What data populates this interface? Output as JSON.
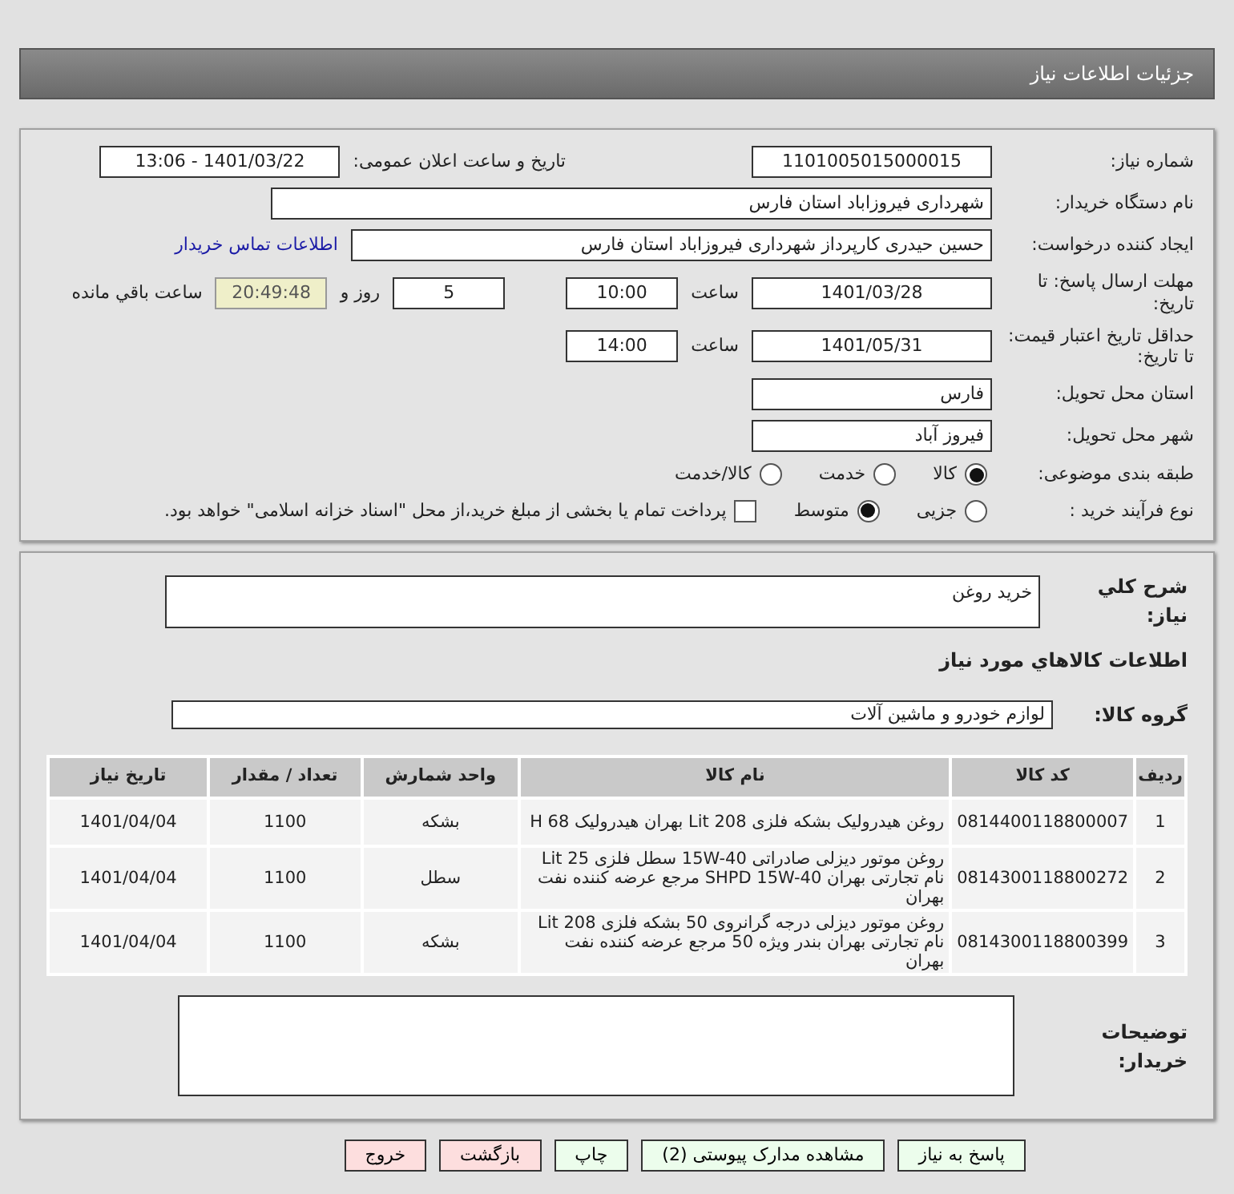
{
  "header": {
    "title": "جزئیات اطلاعات نیاز"
  },
  "need_number": {
    "label": "شماره نیاز:",
    "value": "1101005015000015"
  },
  "announce": {
    "label": "تاریخ و ساعت اعلان عمومی:",
    "value": "1401/03/22 - 13:06"
  },
  "buyer_org": {
    "label": "نام دستگاه خریدار:",
    "value": "شهرداری فیروزاباد استان فارس"
  },
  "requester": {
    "label": "ایجاد کننده درخواست:",
    "value": "حسین حیدری کارپرداز شهرداری فیروزاباد استان فارس",
    "link": "اطلاعات تماس خریدار"
  },
  "reply_deadline": {
    "label": "مهلت ارسال پاسخ: تا تاریخ:",
    "date": "1401/03/28",
    "time_label": "ساعت",
    "time": "10:00",
    "days": "5",
    "days_label": "روز و",
    "remaining": "20:49:48",
    "remaining_label": "ساعت باقي مانده"
  },
  "price_validity": {
    "label": "حداقل تاریخ اعتبار قیمت: تا تاریخ:",
    "date": "1401/05/31",
    "time_label": "ساعت",
    "time": "14:00"
  },
  "province": {
    "label": "استان محل تحویل:",
    "value": "فارس"
  },
  "city": {
    "label": "شهر محل تحویل:",
    "value": "فیروز آباد"
  },
  "category": {
    "label": "طبقه بندی موضوعی:",
    "options": [
      {
        "label": "کالا",
        "selected": true
      },
      {
        "label": "خدمت",
        "selected": false
      },
      {
        "label": "کالا/خدمت",
        "selected": false
      }
    ]
  },
  "process": {
    "label": "نوع فرآیند خرید :",
    "options": [
      {
        "label": "جزیی",
        "selected": false
      },
      {
        "label": "متوسط",
        "selected": true
      }
    ],
    "treasury": {
      "checked": false,
      "text": "پرداخت تمام یا بخشی از مبلغ خرید،از محل \"اسناد خزانه اسلامی\" خواهد بود."
    }
  },
  "description": {
    "label": "شرح کلي نياز:",
    "value": "خرید روغن"
  },
  "goods_heading": "اطلاعات کالاهاي مورد نياز",
  "goods_group": {
    "label": "گروه کالا:",
    "value": "لوازم خودرو و ماشین آلات"
  },
  "table": {
    "columns": [
      "ردیف",
      "کد کالا",
      "نام کالا",
      "واحد شمارش",
      "تعداد / مقدار",
      "تاریخ نیاز"
    ],
    "rows": [
      [
        "1",
        "0814400118800007",
        "روغن هیدرولیک بشکه فلزی 208 Lit بهران هیدرولیک H 68",
        "بشکه",
        "1100",
        "1401/04/04"
      ],
      [
        "2",
        "0814300118800272",
        "روغن موتور دیزلی صادراتی 15W-40 سطل فلزی 25 Lit نام تجارتی بهران SHPD 15W-40 مرجع عرضه کننده نفت بهران",
        "سطل",
        "1100",
        "1401/04/04"
      ],
      [
        "3",
        "0814300118800399",
        "روغن موتور دیزلی درجه گرانروی 50 بشکه فلزی 208 Lit نام تجارتی بهران بندر ویژه 50 مرجع عرضه کننده نفت بهران",
        "بشکه",
        "1100",
        "1401/04/04"
      ]
    ]
  },
  "buyer_notes": {
    "label": "توضیحات خریدار:"
  },
  "buttons": [
    {
      "label": "پاسخ به نیاز",
      "kind": "action"
    },
    {
      "label": "مشاهده مدارک پیوستی (2)",
      "kind": "action"
    },
    {
      "label": "چاپ",
      "kind": "action"
    },
    {
      "label": "بازگشت",
      "kind": "nav"
    },
    {
      "label": "خروج",
      "kind": "nav"
    }
  ]
}
